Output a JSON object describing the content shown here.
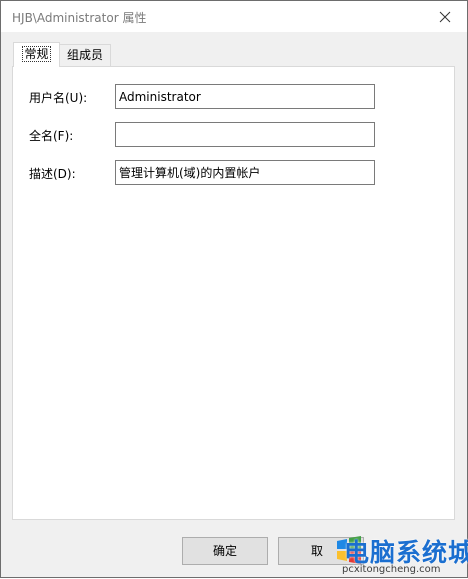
{
  "window": {
    "title": "HJB\\Administrator 属性"
  },
  "tabs": [
    {
      "label": "常规",
      "active": true
    },
    {
      "label": "组成员",
      "active": false
    }
  ],
  "fields": {
    "username": {
      "label": "用户名(U):",
      "value": "Administrator"
    },
    "fullname": {
      "label": "全名(F):",
      "value": ""
    },
    "description": {
      "label": "描述(D):",
      "value": "管理计算机(域)的内置帐户"
    }
  },
  "buttons": {
    "ok": "确定",
    "cancel": "取"
  },
  "watermark": {
    "title": "电脑系统城",
    "url": "pcxitongcheng.com",
    "icon": "windows-logo-icon"
  },
  "colors": {
    "tab_border": "#d9d9d9",
    "dialog_bg": "#f0f0f0",
    "button_bg": "#e1e1e1",
    "watermark_blue": "#1b6fd0"
  }
}
